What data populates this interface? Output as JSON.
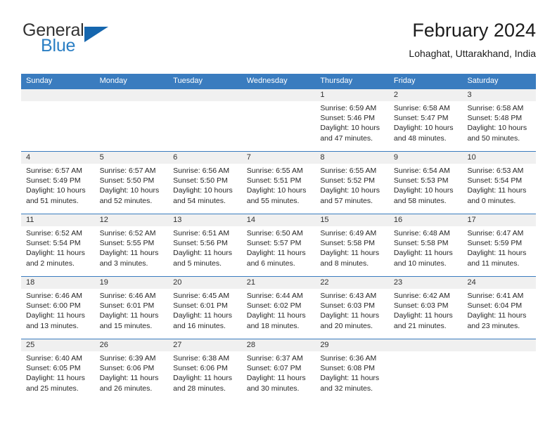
{
  "brand": {
    "name_top": "General",
    "name_bottom": "Blue",
    "accent_color": "#2b7fc4",
    "flag_color": "#1566ae"
  },
  "header": {
    "title": "February 2024",
    "subtitle": "Lohaghat, Uttarakhand, India",
    "header_bg_color": "#3a7cbf",
    "header_text_color": "#ffffff"
  },
  "weekday_headers": [
    "Sunday",
    "Monday",
    "Tuesday",
    "Wednesday",
    "Thursday",
    "Friday",
    "Saturday"
  ],
  "weeks": [
    {
      "days": [
        {
          "number": "",
          "sunrise": "",
          "sunset": "",
          "daylight_1": "",
          "daylight_2": ""
        },
        {
          "number": "",
          "sunrise": "",
          "sunset": "",
          "daylight_1": "",
          "daylight_2": ""
        },
        {
          "number": "",
          "sunrise": "",
          "sunset": "",
          "daylight_1": "",
          "daylight_2": ""
        },
        {
          "number": "",
          "sunrise": "",
          "sunset": "",
          "daylight_1": "",
          "daylight_2": ""
        },
        {
          "number": "1",
          "sunrise": "Sunrise: 6:59 AM",
          "sunset": "Sunset: 5:46 PM",
          "daylight_1": "Daylight: 10 hours",
          "daylight_2": "and 47 minutes."
        },
        {
          "number": "2",
          "sunrise": "Sunrise: 6:58 AM",
          "sunset": "Sunset: 5:47 PM",
          "daylight_1": "Daylight: 10 hours",
          "daylight_2": "and 48 minutes."
        },
        {
          "number": "3",
          "sunrise": "Sunrise: 6:58 AM",
          "sunset": "Sunset: 5:48 PM",
          "daylight_1": "Daylight: 10 hours",
          "daylight_2": "and 50 minutes."
        }
      ]
    },
    {
      "days": [
        {
          "number": "4",
          "sunrise": "Sunrise: 6:57 AM",
          "sunset": "Sunset: 5:49 PM",
          "daylight_1": "Daylight: 10 hours",
          "daylight_2": "and 51 minutes."
        },
        {
          "number": "5",
          "sunrise": "Sunrise: 6:57 AM",
          "sunset": "Sunset: 5:50 PM",
          "daylight_1": "Daylight: 10 hours",
          "daylight_2": "and 52 minutes."
        },
        {
          "number": "6",
          "sunrise": "Sunrise: 6:56 AM",
          "sunset": "Sunset: 5:50 PM",
          "daylight_1": "Daylight: 10 hours",
          "daylight_2": "and 54 minutes."
        },
        {
          "number": "7",
          "sunrise": "Sunrise: 6:55 AM",
          "sunset": "Sunset: 5:51 PM",
          "daylight_1": "Daylight: 10 hours",
          "daylight_2": "and 55 minutes."
        },
        {
          "number": "8",
          "sunrise": "Sunrise: 6:55 AM",
          "sunset": "Sunset: 5:52 PM",
          "daylight_1": "Daylight: 10 hours",
          "daylight_2": "and 57 minutes."
        },
        {
          "number": "9",
          "sunrise": "Sunrise: 6:54 AM",
          "sunset": "Sunset: 5:53 PM",
          "daylight_1": "Daylight: 10 hours",
          "daylight_2": "and 58 minutes."
        },
        {
          "number": "10",
          "sunrise": "Sunrise: 6:53 AM",
          "sunset": "Sunset: 5:54 PM",
          "daylight_1": "Daylight: 11 hours",
          "daylight_2": "and 0 minutes."
        }
      ]
    },
    {
      "days": [
        {
          "number": "11",
          "sunrise": "Sunrise: 6:52 AM",
          "sunset": "Sunset: 5:54 PM",
          "daylight_1": "Daylight: 11 hours",
          "daylight_2": "and 2 minutes."
        },
        {
          "number": "12",
          "sunrise": "Sunrise: 6:52 AM",
          "sunset": "Sunset: 5:55 PM",
          "daylight_1": "Daylight: 11 hours",
          "daylight_2": "and 3 minutes."
        },
        {
          "number": "13",
          "sunrise": "Sunrise: 6:51 AM",
          "sunset": "Sunset: 5:56 PM",
          "daylight_1": "Daylight: 11 hours",
          "daylight_2": "and 5 minutes."
        },
        {
          "number": "14",
          "sunrise": "Sunrise: 6:50 AM",
          "sunset": "Sunset: 5:57 PM",
          "daylight_1": "Daylight: 11 hours",
          "daylight_2": "and 6 minutes."
        },
        {
          "number": "15",
          "sunrise": "Sunrise: 6:49 AM",
          "sunset": "Sunset: 5:58 PM",
          "daylight_1": "Daylight: 11 hours",
          "daylight_2": "and 8 minutes."
        },
        {
          "number": "16",
          "sunrise": "Sunrise: 6:48 AM",
          "sunset": "Sunset: 5:58 PM",
          "daylight_1": "Daylight: 11 hours",
          "daylight_2": "and 10 minutes."
        },
        {
          "number": "17",
          "sunrise": "Sunrise: 6:47 AM",
          "sunset": "Sunset: 5:59 PM",
          "daylight_1": "Daylight: 11 hours",
          "daylight_2": "and 11 minutes."
        }
      ]
    },
    {
      "days": [
        {
          "number": "18",
          "sunrise": "Sunrise: 6:46 AM",
          "sunset": "Sunset: 6:00 PM",
          "daylight_1": "Daylight: 11 hours",
          "daylight_2": "and 13 minutes."
        },
        {
          "number": "19",
          "sunrise": "Sunrise: 6:46 AM",
          "sunset": "Sunset: 6:01 PM",
          "daylight_1": "Daylight: 11 hours",
          "daylight_2": "and 15 minutes."
        },
        {
          "number": "20",
          "sunrise": "Sunrise: 6:45 AM",
          "sunset": "Sunset: 6:01 PM",
          "daylight_1": "Daylight: 11 hours",
          "daylight_2": "and 16 minutes."
        },
        {
          "number": "21",
          "sunrise": "Sunrise: 6:44 AM",
          "sunset": "Sunset: 6:02 PM",
          "daylight_1": "Daylight: 11 hours",
          "daylight_2": "and 18 minutes."
        },
        {
          "number": "22",
          "sunrise": "Sunrise: 6:43 AM",
          "sunset": "Sunset: 6:03 PM",
          "daylight_1": "Daylight: 11 hours",
          "daylight_2": "and 20 minutes."
        },
        {
          "number": "23",
          "sunrise": "Sunrise: 6:42 AM",
          "sunset": "Sunset: 6:03 PM",
          "daylight_1": "Daylight: 11 hours",
          "daylight_2": "and 21 minutes."
        },
        {
          "number": "24",
          "sunrise": "Sunrise: 6:41 AM",
          "sunset": "Sunset: 6:04 PM",
          "daylight_1": "Daylight: 11 hours",
          "daylight_2": "and 23 minutes."
        }
      ]
    },
    {
      "days": [
        {
          "number": "25",
          "sunrise": "Sunrise: 6:40 AM",
          "sunset": "Sunset: 6:05 PM",
          "daylight_1": "Daylight: 11 hours",
          "daylight_2": "and 25 minutes."
        },
        {
          "number": "26",
          "sunrise": "Sunrise: 6:39 AM",
          "sunset": "Sunset: 6:06 PM",
          "daylight_1": "Daylight: 11 hours",
          "daylight_2": "and 26 minutes."
        },
        {
          "number": "27",
          "sunrise": "Sunrise: 6:38 AM",
          "sunset": "Sunset: 6:06 PM",
          "daylight_1": "Daylight: 11 hours",
          "daylight_2": "and 28 minutes."
        },
        {
          "number": "28",
          "sunrise": "Sunrise: 6:37 AM",
          "sunset": "Sunset: 6:07 PM",
          "daylight_1": "Daylight: 11 hours",
          "daylight_2": "and 30 minutes."
        },
        {
          "number": "29",
          "sunrise": "Sunrise: 6:36 AM",
          "sunset": "Sunset: 6:08 PM",
          "daylight_1": "Daylight: 11 hours",
          "daylight_2": "and 32 minutes."
        },
        {
          "number": "",
          "sunrise": "",
          "sunset": "",
          "daylight_1": "",
          "daylight_2": ""
        },
        {
          "number": "",
          "sunrise": "",
          "sunset": "",
          "daylight_1": "",
          "daylight_2": ""
        }
      ]
    }
  ]
}
